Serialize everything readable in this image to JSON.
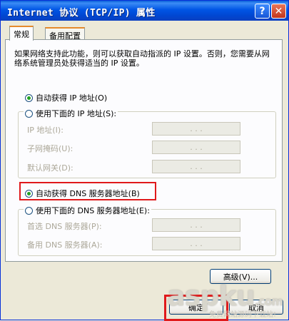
{
  "window": {
    "title": "Internet 协议 (TCP/IP) 属性",
    "help_label": "?",
    "close_label": "✕"
  },
  "tabs": [
    {
      "label": "常规",
      "active": true
    },
    {
      "label": "备用配置",
      "active": false
    }
  ],
  "description": "如果网络支持此功能，则可以获取自动指派的 IP 设置。否则，您需要从网络系统管理员处获得适当的 IP 设置。",
  "ip_section": {
    "auto_label": "自动获得 IP 地址(O)",
    "auto_selected": true,
    "manual_label": "使用下面的 IP 地址(S):",
    "manual_selected": false,
    "fields": [
      {
        "label": "IP 地址(I):",
        "value": ". . ."
      },
      {
        "label": "子网掩码(U):",
        "value": ". . ."
      },
      {
        "label": "默认网关(D):",
        "value": ". . ."
      }
    ]
  },
  "dns_section": {
    "auto_label": "自动获得 DNS 服务器地址(B)",
    "auto_selected": true,
    "manual_label": "使用下面的 DNS 服务器地址(E):",
    "manual_selected": false,
    "fields": [
      {
        "label": "首选 DNS 服务器(P):",
        "value": ". . ."
      },
      {
        "label": "备用 DNS 服务器(A):",
        "value": ". . ."
      }
    ]
  },
  "buttons": {
    "advanced": "高级(V)...",
    "ok": "确定",
    "cancel": "取消"
  },
  "watermark": {
    "text": "aspku",
    "domain": ".com",
    "sub": "免费网站源码下载站!"
  },
  "colors": {
    "title_bar": "#0055e5",
    "highlight": "#e0191b",
    "radio_dot": "#21a121"
  }
}
